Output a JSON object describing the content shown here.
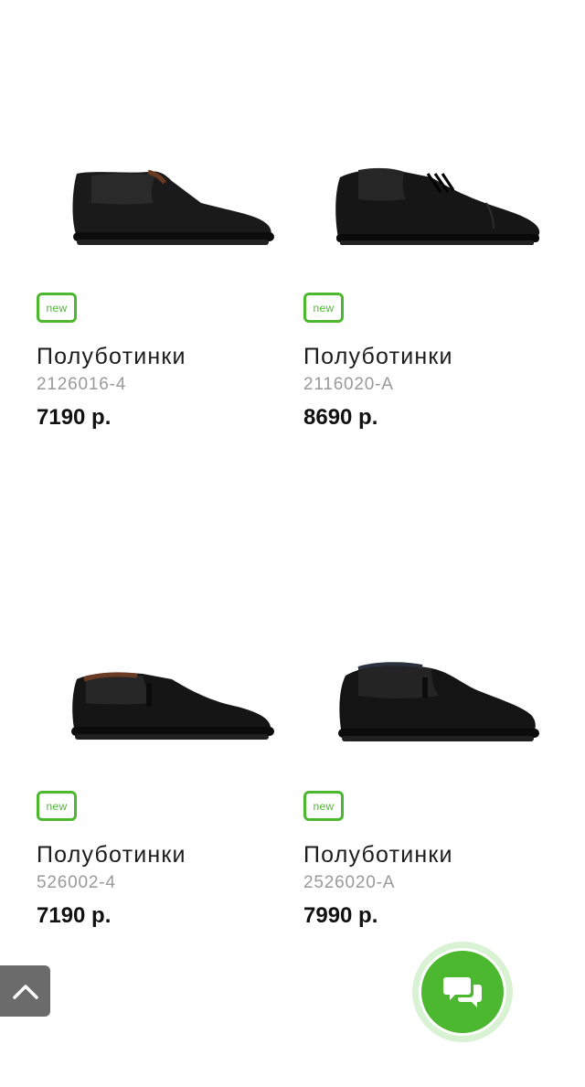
{
  "products": [
    {
      "badge": "new",
      "title": "Полуботинки",
      "sku": "2126016-4",
      "price": "7190 р.",
      "image": "black-slip-on-shoe-image"
    },
    {
      "badge": "new",
      "title": "Полуботинки",
      "sku": "2116020-A",
      "price": "8690 р.",
      "image": "black-lace-up-derby-shoe-image"
    },
    {
      "badge": "new",
      "title": "Полуботинки",
      "sku": "526002-4",
      "price": "7190 р.",
      "image": "black-slip-on-shoe-image"
    },
    {
      "badge": "new",
      "title": "Полуботинки",
      "sku": "2526020-A",
      "price": "7990 р.",
      "image": "black-slip-on-shoe-image"
    }
  ],
  "colors": {
    "accent": "#4cb82f",
    "scroll_button": "#6b6b6b",
    "sku_text": "#9a9a9a"
  },
  "icons": {
    "scroll_top": "chevron-up-icon",
    "chat": "chat-bubbles-icon"
  }
}
